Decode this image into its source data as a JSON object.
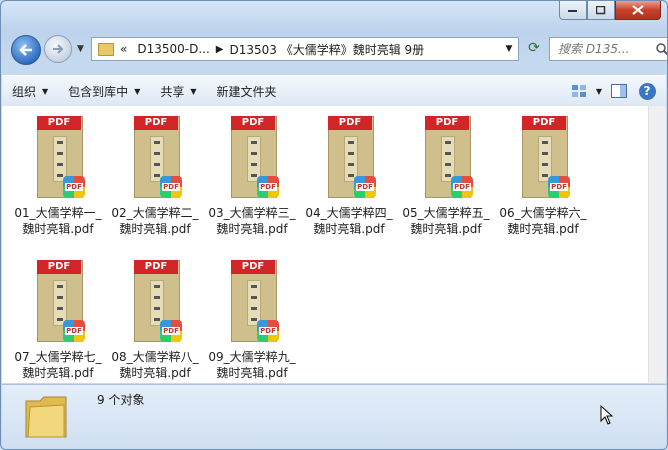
{
  "window": {
    "controls": {
      "minimize_icon": "minimize-icon",
      "maximize_icon": "maximize-icon",
      "close_icon": "close-icon"
    }
  },
  "nav": {
    "breadcrumbs": [
      "«",
      "D13500-D...",
      "D13503 《大儒学粹》魏时亮辑 9册"
    ],
    "search_placeholder": "搜索 D135..."
  },
  "toolbar": {
    "organize": "组织",
    "include_in_library": "包含到库中",
    "share": "共享",
    "new_folder": "新建文件夹"
  },
  "files": [
    {
      "name": "01_大儒学粹一_魏时亮辑.pdf"
    },
    {
      "name": "02_大儒学粹二_魏时亮辑.pdf"
    },
    {
      "name": "03_大儒学粹三_魏时亮辑.pdf"
    },
    {
      "name": "04_大儒学粹四_魏时亮辑.pdf"
    },
    {
      "name": "05_大儒学粹五_魏时亮辑.pdf"
    },
    {
      "name": "06_大儒学粹六_魏时亮辑.pdf"
    },
    {
      "name": "07_大儒学粹七_魏时亮辑.pdf"
    },
    {
      "name": "08_大儒学粹八_魏时亮辑.pdf"
    },
    {
      "name": "09_大儒学粹九_魏时亮辑.pdf"
    }
  ],
  "thumb_badge": "PDF",
  "status": {
    "count_text": "9 个对象"
  },
  "colors": {
    "pdf_red": "#d22525",
    "frame": "#c5d9ef"
  }
}
